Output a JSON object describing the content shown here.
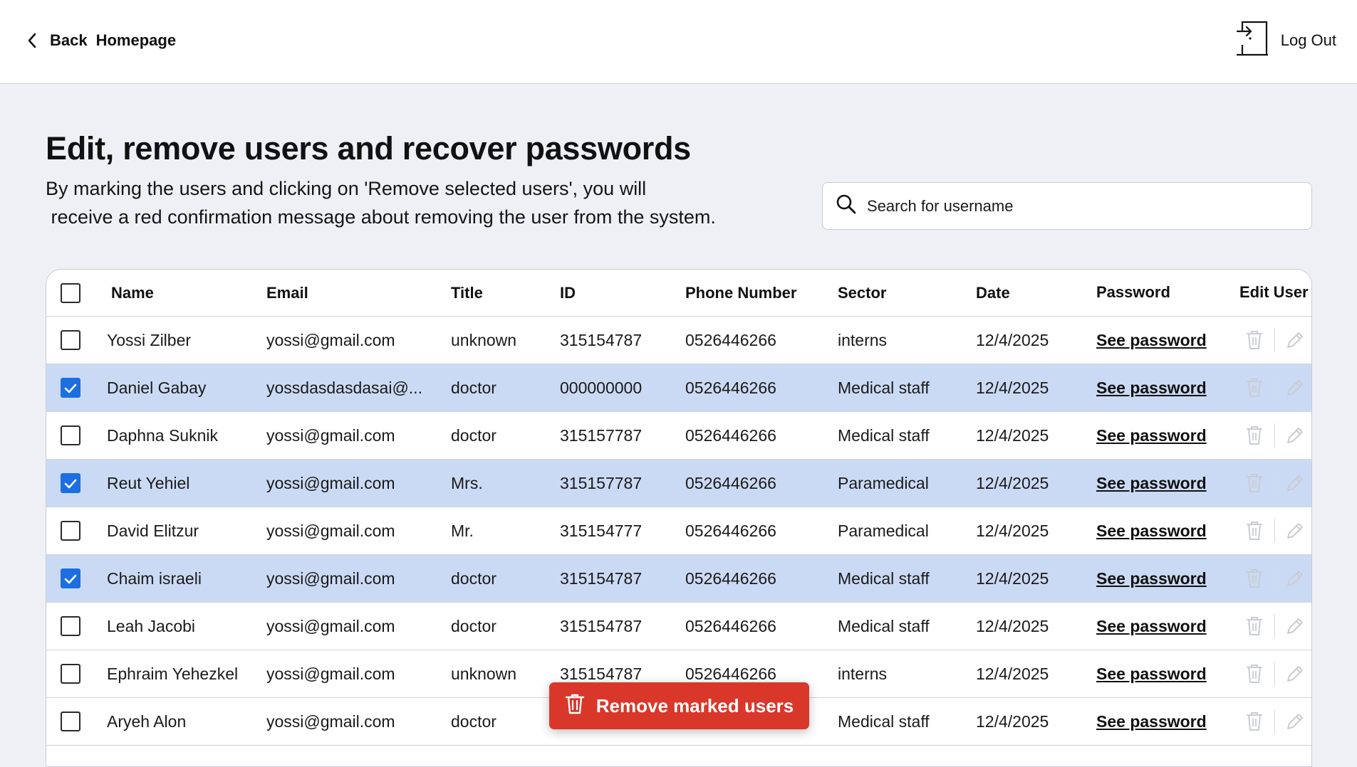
{
  "nav": {
    "back_label": "Back",
    "home_label": "Homepage",
    "logout_label": "Log Out"
  },
  "page": {
    "title": "Edit, remove users and recover passwords",
    "desc_line1": "By marking the users and clicking on 'Remove selected users', you will",
    "desc_line2": " receive a red confirmation message about removing the user from the system."
  },
  "search": {
    "placeholder": "Search for username",
    "value": ""
  },
  "table": {
    "headers": {
      "name": "Name",
      "email": "Email",
      "title": "Title",
      "id": "ID",
      "phone": "Phone Number",
      "sector": "Sector",
      "date": "Date",
      "password": "Password",
      "edit": "Edit User"
    },
    "rows": [
      {
        "name": "Yossi Zilber",
        "email": "yossi@gmail.com",
        "title": "unknown",
        "id": "315154787",
        "phone": "0526446266",
        "sector": "interns",
        "date": "12/4/2025",
        "password_link": "See password",
        "checked": false
      },
      {
        "name": "Daniel Gabay",
        "email": "yossdasdasdasai@...",
        "title": "doctor",
        "id": "000000000",
        "phone": "0526446266",
        "sector": "Medical staff",
        "date": "12/4/2025",
        "password_link": "See password",
        "checked": true
      },
      {
        "name": "Daphna Suknik",
        "email": "yossi@gmail.com",
        "title": "doctor",
        "id": "315157787",
        "phone": "0526446266",
        "sector": "Medical staff",
        "date": "12/4/2025",
        "password_link": "See password",
        "checked": false
      },
      {
        "name": "Reut Yehiel",
        "email": "yossi@gmail.com",
        "title": "Mrs.",
        "id": "315157787",
        "phone": "0526446266",
        "sector": "Paramedical",
        "date": "12/4/2025",
        "password_link": "See password",
        "checked": true
      },
      {
        "name": "David Elitzur",
        "email": "yossi@gmail.com",
        "title": "Mr.",
        "id": "315154777",
        "phone": "0526446266",
        "sector": "Paramedical",
        "date": "12/4/2025",
        "password_link": "See password",
        "checked": false
      },
      {
        "name": "Chaim israeli",
        "email": "yossi@gmail.com",
        "title": "doctor",
        "id": "315154787",
        "phone": "0526446266",
        "sector": "Medical staff",
        "date": "12/4/2025",
        "password_link": "See password",
        "checked": true
      },
      {
        "name": "Leah Jacobi",
        "email": "yossi@gmail.com",
        "title": "doctor",
        "id": "315154787",
        "phone": "0526446266",
        "sector": "Medical staff",
        "date": "12/4/2025",
        "password_link": "See password",
        "checked": false
      },
      {
        "name": "Ephraim Yehezkel",
        "email": "yossi@gmail.com",
        "title": "unknown",
        "id": "315154787",
        "phone": "0526446266",
        "sector": "interns",
        "date": "12/4/2025",
        "password_link": "See password",
        "checked": false
      },
      {
        "name": "Aryeh Alon",
        "email": "yossi@gmail.com",
        "title": "doctor",
        "id": "",
        "phone": "",
        "sector": "Medical staff",
        "date": "12/4/2025",
        "password_link": "See password",
        "checked": false
      }
    ]
  },
  "remove_button": {
    "label": "Remove marked users"
  },
  "icons": {
    "back": "chevron-left-icon",
    "logout": "logout-door-icon",
    "search": "search-icon",
    "delete": "trash-icon",
    "edit": "pencil-icon",
    "check": "check-icon"
  },
  "colors": {
    "selected_row": "#cbdaf4",
    "checkbox_on": "#1b6fe0",
    "danger": "#d9372a",
    "page_bg": "#eef0f5"
  }
}
